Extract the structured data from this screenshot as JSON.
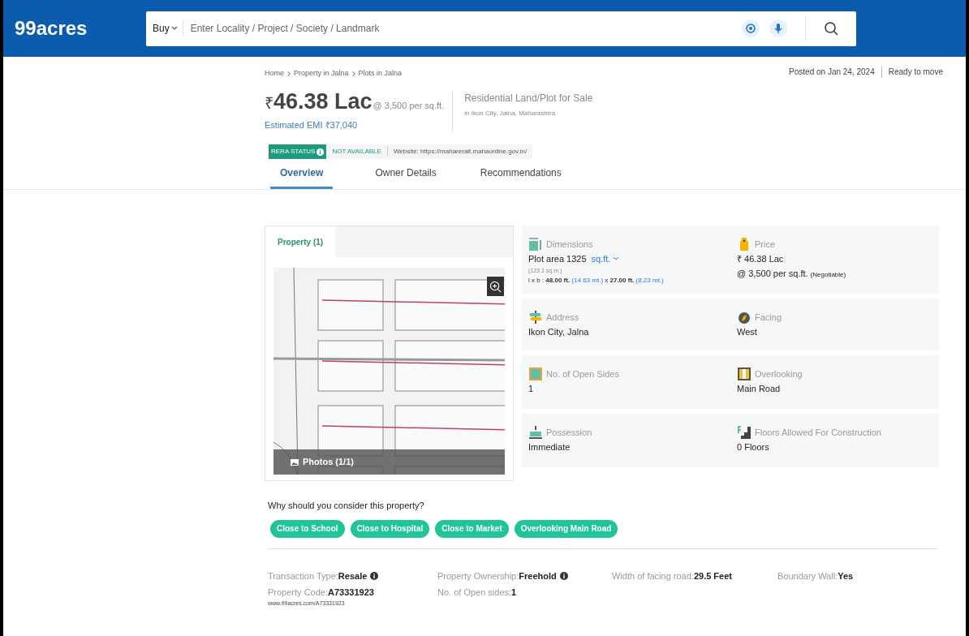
{
  "header": {
    "logo": "99acres",
    "search": {
      "mode": "Buy",
      "placeholder": "Enter Locality / Project / Society / Landmark"
    }
  },
  "breadcrumb": [
    "Home",
    "Property in Jalna",
    "Plots in Jalna"
  ],
  "posted": "Posted on Jan 24, 2024",
  "status": "Ready to move",
  "price": {
    "symbol": "₹",
    "amount": "46.38 Lac",
    "rate": "@ 3,500 per sq.ft.",
    "emi": "Estimated EMI ₹37,040"
  },
  "listing": {
    "title": "Residential Land/Plot for Sale",
    "location": "in Ikon City, Jalna, Maharashtra"
  },
  "rera": {
    "badge": "RERA STATUS",
    "status": "NOT AVAILABLE",
    "website": "Website: https://maharerait.mahaonline.gov.in/"
  },
  "tabs": [
    {
      "label": "Overview",
      "selected": true
    },
    {
      "label": "Owner Details",
      "selected": false
    },
    {
      "label": "Recommendations",
      "selected": false
    }
  ],
  "gallery": {
    "tab": "Property (1)",
    "photos": "Photos (1/1)",
    "kind": "picture"
  },
  "details": [
    {
      "kind": "dimensions",
      "label": "Dimensions",
      "lines": [
        {
          "text": "Plot area 1325",
          "unit": "sq.ft."
        },
        {
          "small": "(123.1 sq.m.)"
        },
        {
          "segments": [
            {
              "text": "l x b : ",
              "kind": "plain"
            },
            {
              "text": "48.00 ft.",
              "kind": "bold"
            },
            {
              "text": " (14.63 mt.)",
              "kind": "metric"
            },
            {
              "text": " x ",
              "kind": "plain"
            },
            {
              "text": "27.00 ft.",
              "kind": "bold"
            },
            {
              "text": " (8.23 mt.)",
              "kind": "metric"
            }
          ]
        }
      ]
    },
    {
      "kind": "price",
      "label": "Price",
      "lines": [
        {
          "text": "₹ 46.38 Lac"
        },
        {
          "text": "@ 3,500 per sq.ft.",
          "note": "(Negotiable)"
        }
      ]
    },
    {
      "kind": "address",
      "label": "Address",
      "lines": [
        {
          "text": "Ikon City, Jalna"
        }
      ]
    },
    {
      "kind": "facing",
      "label": "Facing",
      "lines": [
        {
          "text": "West"
        }
      ]
    },
    {
      "kind": "sides",
      "label": "No. of Open Sides",
      "lines": [
        {
          "text": "1"
        }
      ]
    },
    {
      "kind": "overlooking",
      "label": "Overlooking",
      "lines": [
        {
          "text": "Main Road"
        }
      ]
    },
    {
      "kind": "possession",
      "label": "Possession",
      "lines": [
        {
          "text": "Immediate"
        }
      ]
    },
    {
      "kind": "floors",
      "label": "Floors Allowed For Construction",
      "lines": [
        {
          "text": "0 Floors"
        }
      ]
    }
  ],
  "why": {
    "title": "Why should you consider this property?",
    "tags": [
      "Close to School",
      "Close to Hospital",
      "Close to Market",
      "Overlooking Main Road"
    ]
  },
  "facts": [
    [
      {
        "label": "Transaction Type:",
        "value": "Resale",
        "info": true
      },
      {
        "label": "Property Code:",
        "value": "A73331923",
        "info": false,
        "sub": "www.99acres.com/A73331923"
      }
    ],
    [
      {
        "label": "Property Ownership:",
        "value": "Freehold",
        "info": true
      },
      {
        "label": "No. of Open sides:",
        "value": "1",
        "info": false
      }
    ],
    [
      {
        "label": "Width of facing road:",
        "value": "29.5 Feet",
        "info": false
      }
    ],
    [
      {
        "label": "Boundary Wall:",
        "value": "Yes",
        "info": false
      }
    ]
  ]
}
